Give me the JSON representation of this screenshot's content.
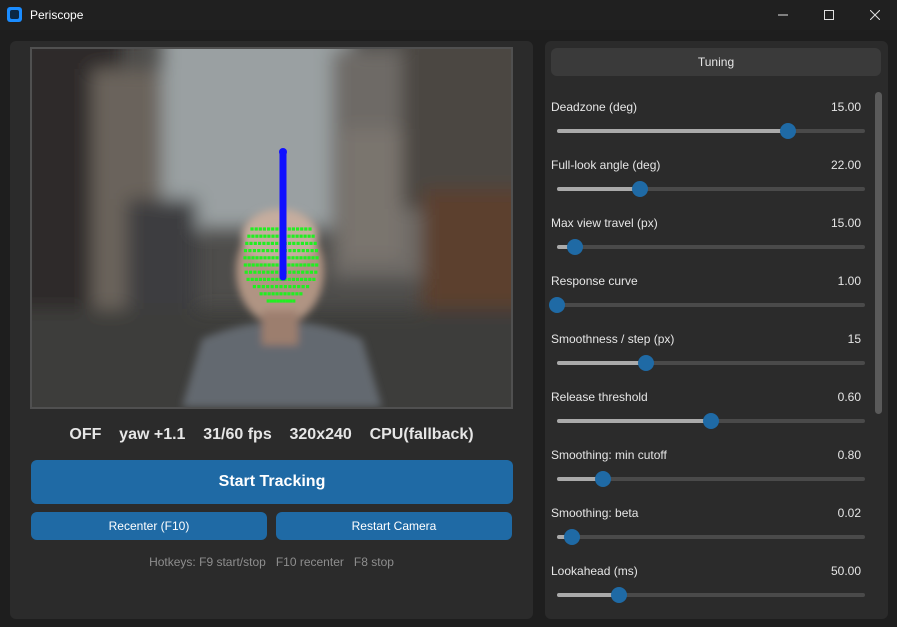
{
  "window": {
    "title": "Periscope",
    "icon": "periscope-app-icon",
    "controls": [
      "minimize-icon",
      "maximize-icon",
      "close-icon"
    ]
  },
  "status": {
    "state": "OFF",
    "yaw": "yaw +1.1",
    "fps": "31/60 fps",
    "resolution": "320x240",
    "device": "CPU(fallback)"
  },
  "buttons": {
    "start": "Start Tracking",
    "recenter": "Recenter (F10)",
    "restart": "Restart Camera"
  },
  "hotkeys": {
    "label": "Hotkeys:",
    "start_stop": "F9 start/stop",
    "recenter": "F10 recenter",
    "stop": "F8 stop"
  },
  "tuning": {
    "title": "Tuning",
    "sliders": [
      {
        "label": "Deadzone (deg)",
        "value": "15.00",
        "fraction": 0.75
      },
      {
        "label": "Full-look angle (deg)",
        "value": "22.00",
        "fraction": 0.27
      },
      {
        "label": "Max view travel (px)",
        "value": "15.00",
        "fraction": 0.06
      },
      {
        "label": "Response curve",
        "value": "1.00",
        "fraction": 0.0
      },
      {
        "label": "Smoothness / step (px)",
        "value": "15",
        "fraction": 0.29
      },
      {
        "label": "Release threshold",
        "value": "0.60",
        "fraction": 0.5
      },
      {
        "label": "Smoothing: min cutoff",
        "value": "0.80",
        "fraction": 0.15
      },
      {
        "label": "Smoothing: beta",
        "value": "0.02",
        "fraction": 0.05
      },
      {
        "label": "Lookahead (ms)",
        "value": "50.00",
        "fraction": 0.2
      }
    ]
  },
  "colors": {
    "accent": "#1f6aa5",
    "landmarks": "#22ee22",
    "direction_vector": "#1010ff"
  }
}
